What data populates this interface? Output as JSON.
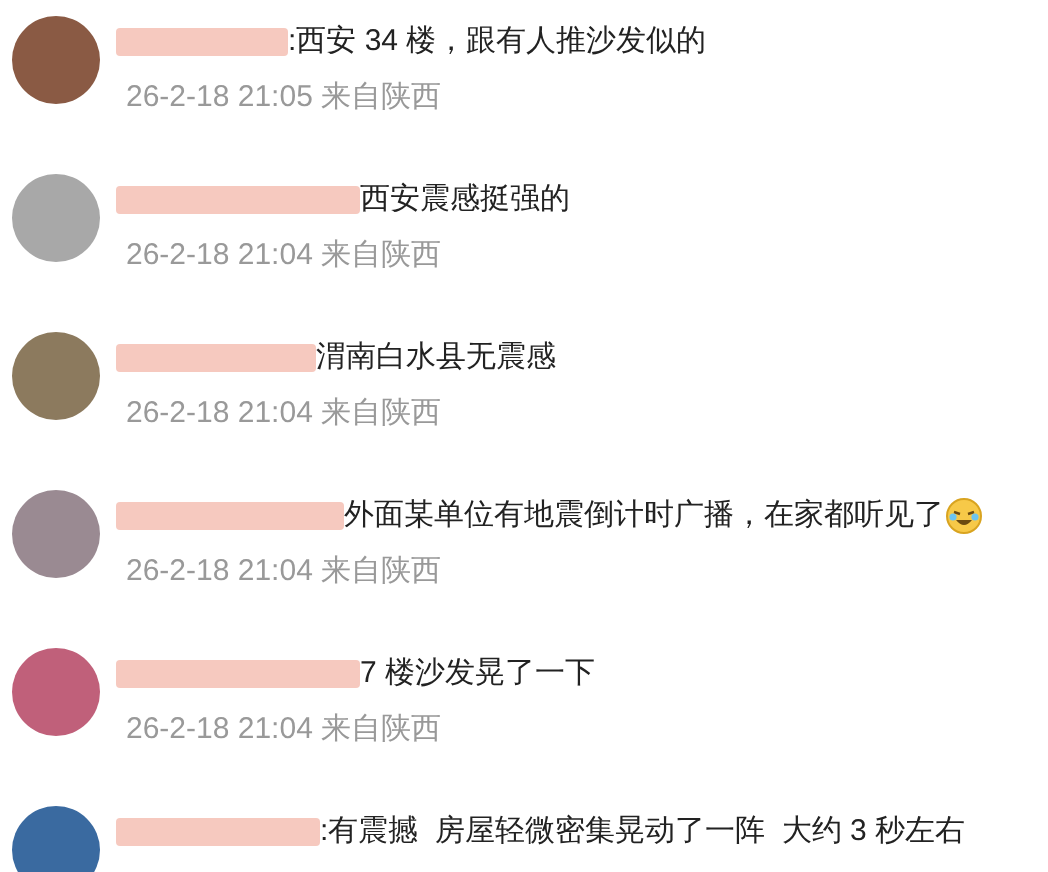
{
  "comments": [
    {
      "color": "#8a5a44",
      "text": ":西安 34 楼，跟有人推沙发似的",
      "time": "26-2-18 21:05 来自陕西",
      "has_emoji": false
    },
    {
      "color": "#a8a8a8",
      "text": "西安震感挺强的",
      "time": "26-2-18 21:04 来自陕西",
      "has_emoji": false
    },
    {
      "color": "#8c7a5e",
      "text": "渭南白水县无震感",
      "time": "26-2-18 21:04 来自陕西",
      "has_emoji": false
    },
    {
      "color": "#9a8a92",
      "text": "外面某单位有地震倒计时广播，在家都听见了",
      "time": "26-2-18 21:04 来自陕西",
      "has_emoji": true
    },
    {
      "color": "#c0607a",
      "text": "7 楼沙发晃了一下",
      "time": "26-2-18 21:04 来自陕西",
      "has_emoji": false
    },
    {
      "color": "#3a6aa0",
      "text": ":有震撼  房屋轻微密集晃动了一阵  大约 3 秒左右",
      "has_emoji": false
    }
  ]
}
